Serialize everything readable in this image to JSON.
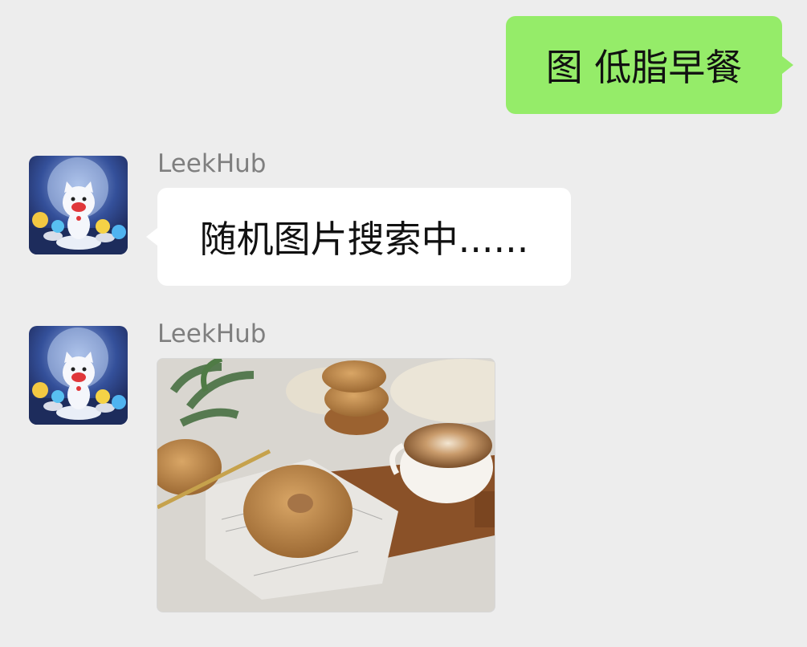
{
  "outgoing_message": {
    "text": "图 低脂早餐"
  },
  "messages": [
    {
      "sender": "LeekHub",
      "text": "随机图片搜索中......"
    },
    {
      "sender": "LeekHub"
    }
  ]
}
